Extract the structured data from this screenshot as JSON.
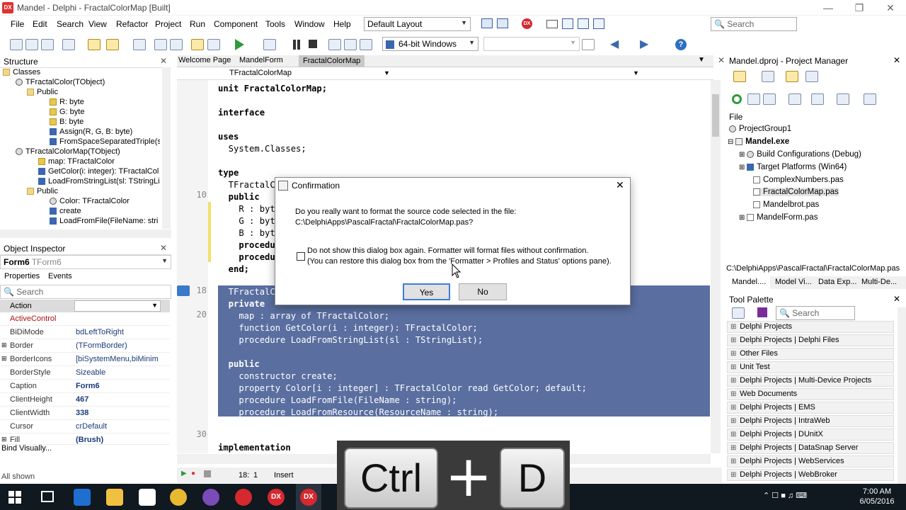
{
  "window": {
    "title": "Mandel - Delphi - FractalColorMap [Built]",
    "logo": "DX"
  },
  "menu": [
    "File",
    "Edit",
    "Search",
    "View",
    "Refactor",
    "Project",
    "Run",
    "Component",
    "Tools",
    "Window",
    "Help"
  ],
  "layout_dropdown": "Default Layout",
  "search_placeholder": "Search",
  "platform_dropdown": "64-bit Windows",
  "structure": {
    "title": "Structure",
    "items": [
      "Classes",
      "TFractalColor(TObject)",
      "Public",
      "R: byte",
      "G: byte",
      "B: byte",
      "Assign(R, G, B: byte)",
      "FromSpaceSeparatedTriple(s",
      "TFractalColorMap(TObject)",
      "map: TFractalColor",
      "GetColor(i: integer): TFractalCol",
      "LoadFromStringList(sl: TStringLi",
      "Public",
      "Color: TFractalColor",
      "create",
      "LoadFromFile(FileName: stri"
    ]
  },
  "object_inspector": {
    "title": "Object Inspector",
    "selected": "Form6",
    "selected_type": "TForm6",
    "tabs": [
      "Properties",
      "Events"
    ],
    "search": "Search",
    "action_label": "Action",
    "props": [
      {
        "k": "ActiveControl",
        "v": ""
      },
      {
        "k": "BiDiMode",
        "v": "bdLeftToRight"
      },
      {
        "k": "Border",
        "v": "(TFormBorder)"
      },
      {
        "k": "BorderIcons",
        "v": "[biSystemMenu,biMinim"
      },
      {
        "k": "BorderStyle",
        "v": "Sizeable"
      },
      {
        "k": "Caption",
        "v": "Form6"
      },
      {
        "k": "ClientHeight",
        "v": "467"
      },
      {
        "k": "ClientWidth",
        "v": "338"
      },
      {
        "k": "Cursor",
        "v": "crDefault"
      },
      {
        "k": "Fill",
        "v": "(Brush)"
      }
    ],
    "bind": "Bind Visually...",
    "all_shown": "All shown"
  },
  "editor": {
    "tabs": [
      "Welcome Page",
      "MandelForm",
      "FractalColorMap"
    ],
    "unit_dropdown": "TFractalColorMap",
    "line_numbers": [
      "10",
      "18",
      "20",
      "30"
    ],
    "status": {
      "pos": "18:",
      "col": "1",
      "mode": "Insert"
    }
  },
  "code": {
    "l1": "unit FractalColorMap;",
    "l2": "interface",
    "l3": "uses",
    "l4": "  System.Classes;",
    "l5": "type",
    "l6": "  TFractalC",
    "l7": "  public",
    "l8": "    R : byt",
    "l9": "    G : byt",
    "l10": "    B : byt",
    "l11": "    procedu",
    "l12": "    procedu",
    "l13": "  end;",
    "l14": "  TFractalC",
    "l15": "  private",
    "l16": "    map : array of TFractalColor;",
    "l17": "    function GetColor(i : integer): TFractalColor;",
    "l18": "    procedure LoadFromStringList(sl : TStringList);",
    "l19": "  public",
    "l20": "    constructor create;",
    "l21": "    property Color[i : integer] : TFractalColor read GetColor; default;",
    "l22": "    procedure LoadFromFile(FileName : string);",
    "l23": "    procedure LoadFromResource(ResourceName : string);",
    "l24": "  end;",
    "l25": "implementation"
  },
  "dialog": {
    "title": "Confirmation",
    "q1": "Do you really want to format the source code selected in the file:",
    "q2": "C:\\DelphiApps\\PascalFractal\\FractalColorMap.pas?",
    "c1": "Do not show this dialog box again. Formatter will format files without confirmation.",
    "c2": "(You can restore this dialog box from the 'Formatter > Profiles and Status' options pane).",
    "yes": "Yes",
    "no": "No"
  },
  "project_manager": {
    "title": "Mandel.dproj - Project Manager",
    "file_label": "File",
    "items": [
      "ProjectGroup1",
      "Mandel.exe",
      "Build Configurations (Debug)",
      "Target Platforms (Win64)",
      "ComplexNumbers.pas",
      "FractalColorMap.pas",
      "Mandelbrot.pas",
      "MandelForm.pas"
    ],
    "path": "C:\\DelphiApps\\PascalFractal\\FractalColorMap.pas",
    "tabs": [
      "Mandel....",
      "Model Vi...",
      "Data Exp...",
      "Multi-De..."
    ]
  },
  "tool_palette": {
    "title": "Tool Palette",
    "search": "Search",
    "items": [
      "Delphi Projects",
      "Delphi Projects | Delphi Files",
      "Other Files",
      "Unit Test",
      "Delphi Projects | Multi-Device Projects",
      "Web Documents",
      "Delphi Projects | EMS",
      "Delphi Projects | IntraWeb",
      "Delphi Projects | DUnitX",
      "Delphi Projects | DataSnap Server",
      "Delphi Projects | WebServices",
      "Delphi Projects | WebBroker"
    ]
  },
  "keys": {
    "k1": "Ctrl",
    "plus": "+",
    "k2": "D"
  },
  "clock": {
    "time": "7:00 AM",
    "date": "6/05/2016"
  },
  "taskbar_dx": "DX"
}
